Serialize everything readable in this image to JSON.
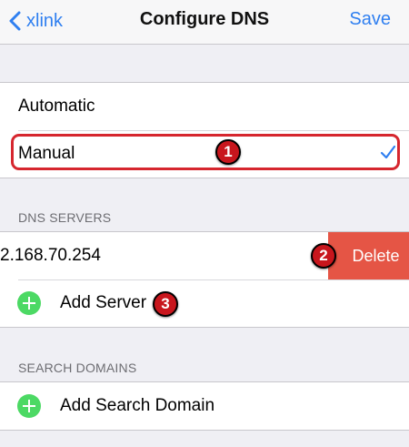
{
  "nav": {
    "back_label": "xlink",
    "title": "Configure DNS",
    "save_label": "Save"
  },
  "mode": {
    "options": [
      {
        "label": "Automatic",
        "selected": false
      },
      {
        "label": "Manual",
        "selected": true
      }
    ]
  },
  "dns_servers": {
    "header": "DNS SERVERS",
    "servers": [
      "2.168.70.254"
    ],
    "delete_label": "Delete",
    "add_label": "Add Server"
  },
  "search_domains": {
    "header": "SEARCH DOMAINS",
    "add_label": "Add Search Domain"
  },
  "annotations": {
    "step1": "1",
    "step2": "2",
    "step3": "3"
  },
  "colors": {
    "accent": "#2f7ff0",
    "delete": "#e55545",
    "add": "#4cd964",
    "annotation": "#c8161d"
  },
  "icons": {
    "back": "chevron-left-icon",
    "check": "checkmark-icon",
    "add": "plus-circle-icon"
  }
}
